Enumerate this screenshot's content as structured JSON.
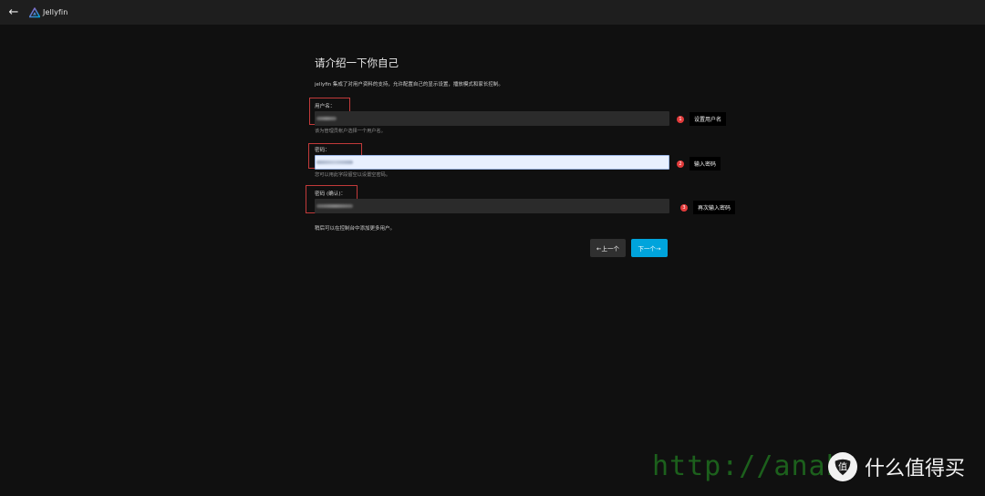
{
  "app": {
    "back_icon": "arrow-left-icon",
    "logo_icon": "jellyfin-triangle-icon",
    "name": "Jellyfin",
    "accent": "#00a4dc"
  },
  "wizard": {
    "title": "请介绍一下你自己",
    "intro": "jellyfin 集成了对用户资料的支持，允许配置自己的显示设置，播放模式和家长控制。",
    "fields": [
      {
        "label": "用户名：",
        "value": "",
        "hint": "该为管理员帐户选择一个用户名。",
        "annotation_number": "1",
        "annotation_label": "设置用户名"
      },
      {
        "label": "密码：",
        "value": "",
        "hint": "您可以用此字段留空以设置空密码。",
        "annotation_number": "2",
        "annotation_label": "输入密码"
      },
      {
        "label": "密码 (确认)：",
        "value": "",
        "hint": "",
        "annotation_number": "3",
        "annotation_label": "再次输入密码"
      }
    ],
    "footnote": "稍后可以在控制台中添加更多用户。",
    "prev_label": "←上一个",
    "next_label": "下一个→"
  },
  "watermark": {
    "url": "http://anah",
    "badge_text": "值",
    "brand": "什么值得买"
  }
}
